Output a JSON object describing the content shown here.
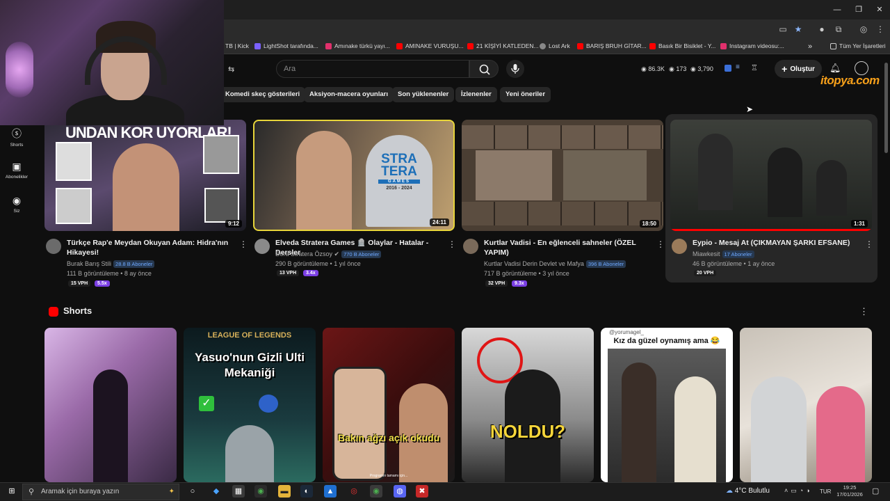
{
  "browser": {
    "bookmarks": [
      {
        "label": "TB | Kick",
        "color": "#53fc18"
      },
      {
        "label": "LightShot tarafında...",
        "color": "#7b61ff"
      },
      {
        "label": "Amınake türkü yayı...",
        "color": "#e1306c"
      },
      {
        "label": "AMINAKE VURUŞU...",
        "color": "#ff0000"
      },
      {
        "label": "21 KİŞİYİ KATLEDEN...",
        "color": "#ff0000"
      },
      {
        "label": "Lost Ark",
        "color": "#888888"
      },
      {
        "label": "BARIŞ BRUH GİTAR...",
        "color": "#ff0000"
      },
      {
        "label": "Basık Bir Bisiklet - Y...",
        "color": "#ff0000"
      },
      {
        "label": "Instagram videosu:...",
        "color": "#e1306c"
      }
    ],
    "more_bookmarks": "»",
    "all_bookmarks": "Tüm Yer İşaretleri"
  },
  "header": {
    "search_placeholder": "Ara",
    "stats": {
      "views": "86.3K",
      "watch": "173",
      "other": "3,790"
    },
    "create_label": "Oluştur",
    "watermark": "itopya.com"
  },
  "chips": [
    "Komedi skeç gösterileri",
    "Aksiyon-macera oyunları",
    "Son yüklenenler",
    "İzlenenler",
    "Yeni öneriler"
  ],
  "sidebar": [
    {
      "label": "Shorts",
      "icon": "shorts-icon"
    },
    {
      "label": "Abonelikler",
      "icon": "subscriptions-icon"
    },
    {
      "label": "Siz",
      "icon": "you-icon"
    }
  ],
  "videos": [
    {
      "title": "Türkçe Rap'e Meydan Okuyan Adam: Hidra'nın Hikayesi!",
      "channel": "Burak Barış Stili",
      "subs": "28.8 B Aboneler",
      "meta": "111 B görüntüleme • 8 ay önce",
      "vph": "15 VPH",
      "mult": "5.5x",
      "duration": "9:12",
      "thumb_text": "UNDAN KOR UYORLAR!"
    },
    {
      "title": "Elveda Stratera Games 🪦 Olaylar - Hatalar - Dersler",
      "channel": "Dora Stratera Özsoy",
      "subs": "770 B Aboneler",
      "meta": "290 B görüntüleme • 1 yıl önce",
      "vph": "13 VPH",
      "mult": "3.4x",
      "duration": "24:11",
      "thumb_text": "STRA TERA",
      "thumb_sub": "GAMES",
      "thumb_years": "2016 - 2024"
    },
    {
      "title": "Kurtlar Vadisi - En eğlenceli sahneler (ÖZEL YAPIM)",
      "channel": "Kurtlar Vadisi Derin Devlet ve Mafya",
      "subs": "396 B Aboneler",
      "meta": "717 B görüntüleme • 3 yıl önce",
      "vph": "32 VPH",
      "mult": "9.3x",
      "duration": "18:50"
    },
    {
      "title": "Eypio - Mesaj At (ÇIKMAYAN ŞARKI EFSANE)",
      "channel": "Miawkesit",
      "subs": "17 Aboneler",
      "meta": "46 B görüntüleme • 1 ay önce",
      "vph": "20 VPH",
      "duration": "1:31"
    }
  ],
  "shorts_section": {
    "title": "Shorts"
  },
  "shorts": [
    {
      "text": ""
    },
    {
      "text": "Yasuo'nun Gizli Ulti Mekaniği",
      "top": "LEAGUE OF LEGENDS"
    },
    {
      "text": "Bakın ağzı açık okudu",
      "bottom": "Programın tamamı için..."
    },
    {
      "text": "NOLDU?"
    },
    {
      "text": "Kız da güzel oynamış ama 😂",
      "handle": "@yorumagel_"
    },
    {
      "text": ""
    }
  ],
  "taskbar": {
    "search_placeholder": "Aramak için buraya yazın",
    "weather": "4°C Bulutlu",
    "lang": "TUR",
    "time": "19:25",
    "date": "17/01/2026"
  },
  "colors": {
    "accent_red": "#ff0000",
    "subs_blue": "#6ea8ff",
    "mult_purple": "#7b3fe4"
  }
}
